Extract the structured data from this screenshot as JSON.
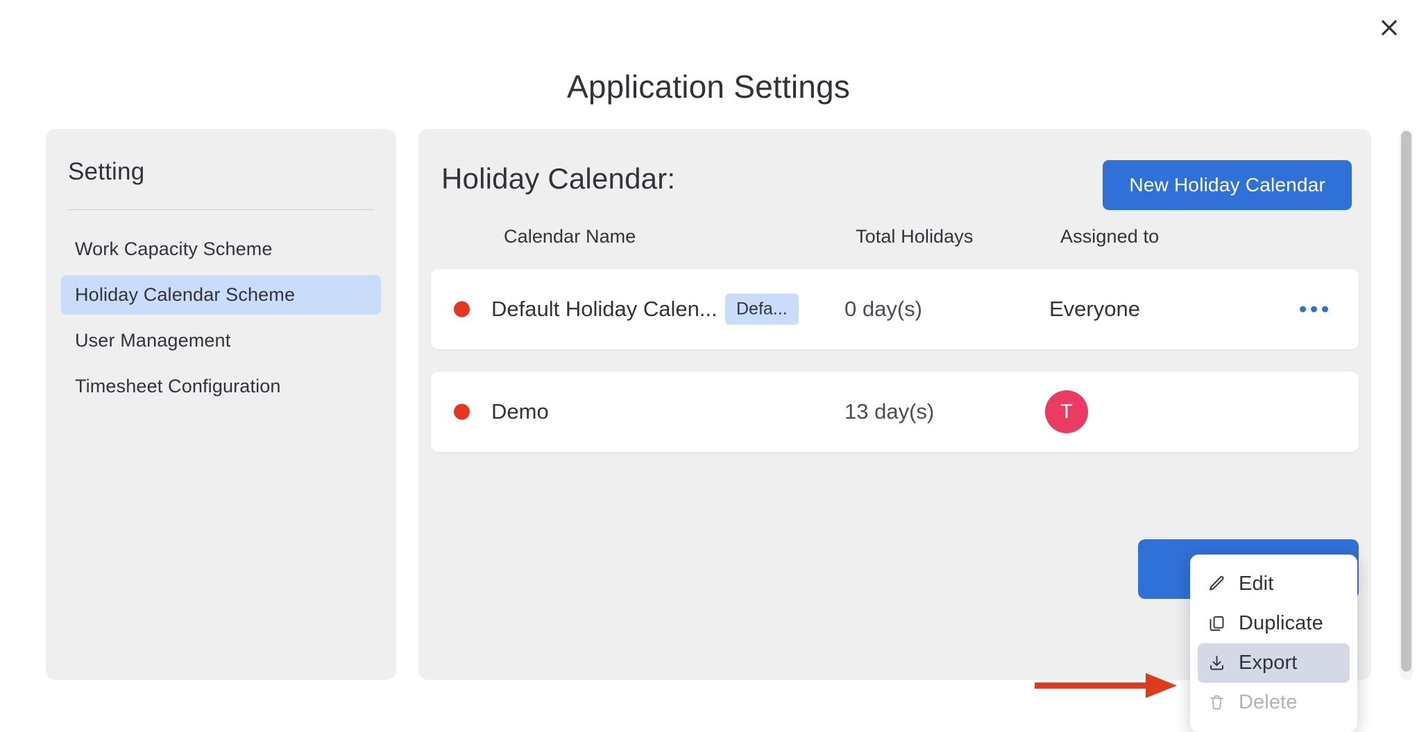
{
  "window": {
    "title": "Application Settings",
    "close_icon": "close-icon"
  },
  "sidebar": {
    "title": "Setting",
    "items": [
      {
        "label": "Work Capacity Scheme",
        "active": false
      },
      {
        "label": "Holiday Calendar Scheme",
        "active": true
      },
      {
        "label": "User Management",
        "active": false
      },
      {
        "label": "Timesheet Configuration",
        "active": false
      }
    ]
  },
  "main": {
    "section_title": "Holiday Calendar:",
    "new_button": "New Holiday Calendar",
    "columns": {
      "name": "Calendar Name",
      "total": "Total Holidays",
      "assigned": "Assigned to"
    },
    "rows": [
      {
        "status_color": "#e8351f",
        "name": "Default Holiday Calen...",
        "badge": "Defa...",
        "total": "0 day(s)",
        "assigned": "Everyone",
        "assigned_type": "text",
        "menu_icon": "more-horizontal-icon"
      },
      {
        "status_color": "#e8351f",
        "name": "Demo",
        "badge": "",
        "total": "13 day(s)",
        "assigned": "T",
        "assigned_type": "avatar",
        "avatar_color": "#ec3b63",
        "menu_icon": "more-horizontal-icon"
      }
    ]
  },
  "context_menu": {
    "items": [
      {
        "label": "Edit",
        "icon": "pencil-icon",
        "state": "normal"
      },
      {
        "label": "Duplicate",
        "icon": "copy-icon",
        "state": "normal"
      },
      {
        "label": "Export",
        "icon": "download-icon",
        "state": "highlighted"
      },
      {
        "label": "Delete",
        "icon": "trash-icon",
        "state": "disabled"
      }
    ]
  },
  "annotation": {
    "arrow_color": "#e03a1c",
    "points_to": "Export"
  },
  "colors": {
    "accent_blue": "#3070d9",
    "panel_bg": "#efeff0",
    "selected_nav": "#c9ddfb",
    "badge_bg": "#c9ddfb",
    "menu_highlight": "#d5d8e6",
    "text": "#32333a"
  }
}
